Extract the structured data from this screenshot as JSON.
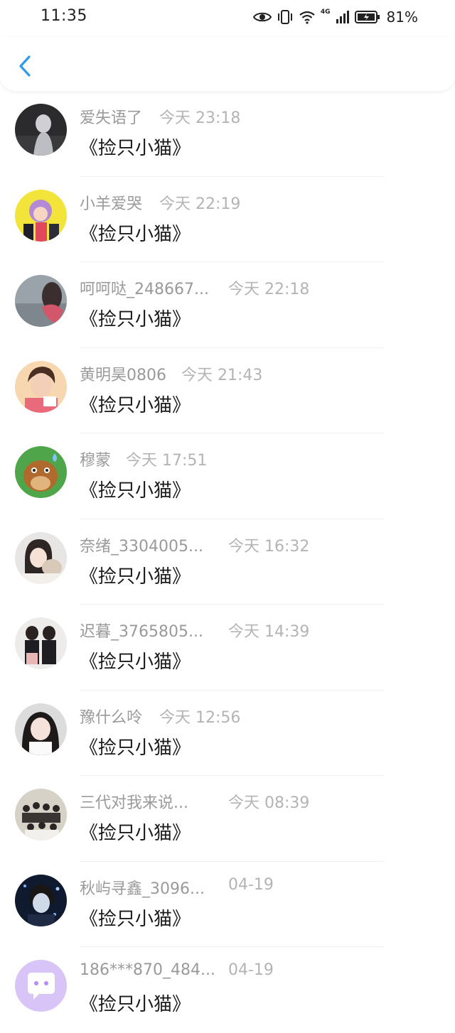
{
  "status_bar": {
    "time": "11:35",
    "network": "4G",
    "battery": "81%"
  },
  "header": {
    "back_icon": "chevron-left-icon",
    "accent": "#2e9bea"
  },
  "messages": [
    {
      "name": "爱失语了",
      "time": "今天 23:18",
      "content": "《捡只小猫》"
    },
    {
      "name": "小羊爱哭",
      "time": "今天 22:19",
      "content": "《捡只小猫》"
    },
    {
      "name": "呵呵哒_248667...",
      "time": "今天 22:18",
      "content": "《捡只小猫》"
    },
    {
      "name": "黄明昊0806",
      "time": "今天 21:43",
      "content": "《捡只小猫》"
    },
    {
      "name": "穆蒙",
      "time": "今天 17:51",
      "content": "《捡只小猫》"
    },
    {
      "name": "奈绪_3304005...",
      "time": "今天 16:32",
      "content": "《捡只小猫》"
    },
    {
      "name": "迟暮_3765805...",
      "time": "今天 14:39",
      "content": "《捡只小猫》"
    },
    {
      "name": "豫什么呤",
      "time": "今天 12:56",
      "content": "《捡只小猫》"
    },
    {
      "name": "三代对我来说...",
      "time": "今天 08:39",
      "content": "《捡只小猫》"
    },
    {
      "name": "秋屿寻鑫_3096...",
      "time": "04-19",
      "content": "《捡只小猫》"
    },
    {
      "name": "186***870_484...",
      "time": "04-19",
      "content": "《捡只小猫》"
    }
  ]
}
